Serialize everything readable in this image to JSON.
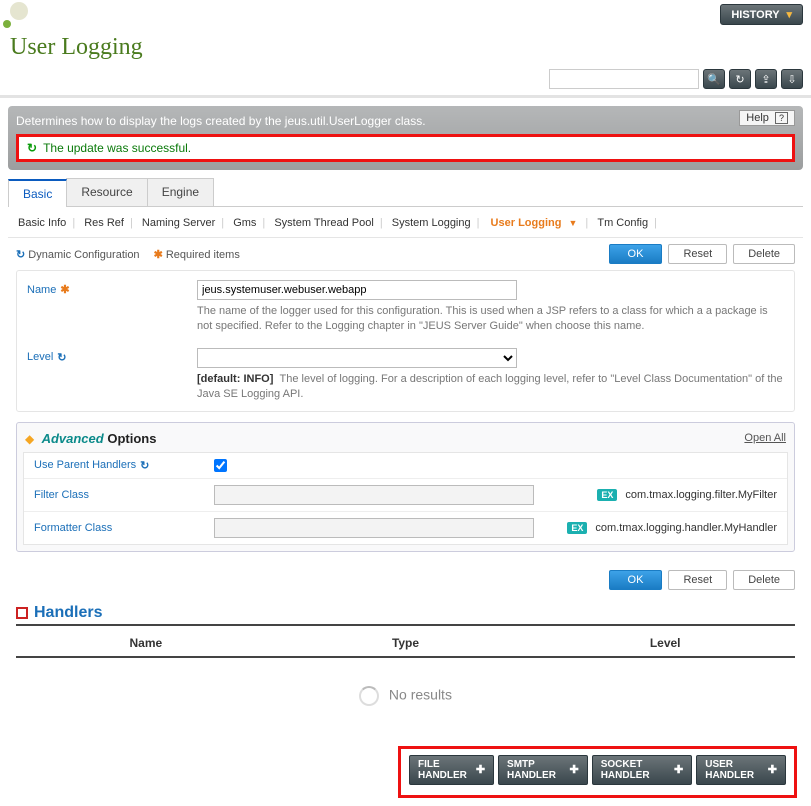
{
  "history_label": "HISTORY",
  "page_title": "User Logging",
  "search_placeholder": "",
  "banner_description": "Determines how to display the logs created by the jeus.util.UserLogger class.",
  "help_label": "Help",
  "success_message": "The update was successful.",
  "tabs": {
    "basic": "Basic",
    "resource": "Resource",
    "engine": "Engine"
  },
  "subnav": {
    "basic_info": "Basic Info",
    "res_ref": "Res Ref",
    "naming_server": "Naming Server",
    "gms": "Gms",
    "system_thread_pool": "System Thread Pool",
    "system_logging": "System Logging",
    "user_logging": "User Logging",
    "tm_config": "Tm Config"
  },
  "legend": {
    "dynamic": "Dynamic Configuration",
    "required": "Required items"
  },
  "buttons": {
    "ok": "OK",
    "reset": "Reset",
    "delete": "Delete"
  },
  "fields": {
    "name_label": "Name",
    "name_value": "jeus.systemuser.webuser.webapp",
    "name_help": "The name of the logger used for this configuration. This is used when a JSP refers to a class for which a a package is not specified. Refer to the Logging chapter in \"JEUS Server Guide\" when choose this name.",
    "level_label": "Level",
    "level_default": "[default: INFO]",
    "level_help": "The level of logging. For a description of each logging level, refer to \"Level Class Documentation\" of the Java SE Logging API."
  },
  "advanced": {
    "title_a": "Advanced",
    "title_b": " Options",
    "open_all": "Open All",
    "use_parent_label": "Use Parent Handlers",
    "filter_class_label": "Filter Class",
    "filter_example": "com.tmax.logging.filter.MyFilter",
    "formatter_class_label": "Formatter Class",
    "formatter_example": "com.tmax.logging.handler.MyHandler",
    "ex_badge": "EX"
  },
  "handlers": {
    "title": "Handlers",
    "col_name": "Name",
    "col_type": "Type",
    "col_level": "Level",
    "no_results": "No results"
  },
  "handler_buttons": {
    "file": "FILE HANDLER",
    "smtp": "SMTP HANDLER",
    "socket": "SOCKET HANDLER",
    "user": "USER HANDLER"
  }
}
